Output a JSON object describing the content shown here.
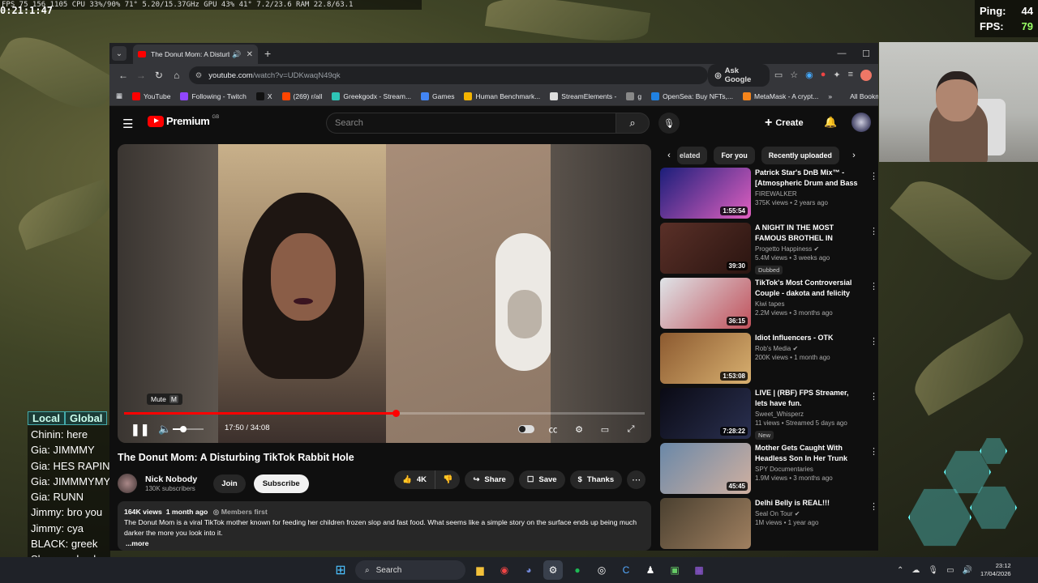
{
  "overlay": {
    "stats": "FPS 75 156 1105   CPU 33%/90%   71°  5.20/15.37GHz   GPU 43%  41°  7.2/23.6   RAM 22.8/63.1",
    "timer": "0:21:1:47",
    "ping_label": "Ping:",
    "ping_value": "44",
    "fps_label": "FPS:",
    "fps_value": "79"
  },
  "chat": {
    "tabs": [
      "Local",
      "Global"
    ],
    "messages": [
      "Chinin:  here",
      "Gia:  JIMMMY",
      "Gia:  HES RAPIN",
      "Gia:  JIMMMYMY",
      "Gia:  RUNN",
      "Jimmy:  bro you",
      "Jimmy:  cya",
      "BLACK:  greek",
      "Skyy:  my bush"
    ]
  },
  "browser": {
    "tab_title": "The Donut Mom: A Disturb",
    "url_prefix": "youtube.com",
    "url_rest": "/watch?v=UDKwaqN49qk",
    "ask_google": "Ask Google",
    "bookmarks": [
      {
        "label": "YouTube",
        "color": "#ff0000"
      },
      {
        "label": "Following - Twitch",
        "color": "#9146ff"
      },
      {
        "label": "X",
        "color": "#111111"
      },
      {
        "label": "(269) r/all",
        "color": "#ff4500"
      },
      {
        "label": "Greekgodx - Stream...",
        "color": "#2ec4b6"
      },
      {
        "label": "Games",
        "color": "#4285f4"
      },
      {
        "label": "Human Benchmark...",
        "color": "#f4b400"
      },
      {
        "label": "StreamElements -",
        "color": "#dddddd"
      },
      {
        "label": "g",
        "color": "#888888"
      },
      {
        "label": "OpenSea: Buy NFTs,...",
        "color": "#2081e2"
      },
      {
        "label": "MetaMask - A crypt...",
        "color": "#f6851b"
      }
    ],
    "all_bookmarks": "All Bookma"
  },
  "youtube": {
    "logo_text": "Premium",
    "logo_region": "GB",
    "search_placeholder": "Search",
    "create_label": "Create",
    "video": {
      "title": "The Donut Mom: A Disturbing TikTok Rabbit Hole",
      "current_time": "17:50",
      "duration": "34:08",
      "progress": 0.5225,
      "volume": 0.35,
      "mute_tooltip": "Mute",
      "mute_key": "M"
    },
    "channel": {
      "name": "Nick Nobody",
      "subs": "130K subscribers",
      "join": "Join",
      "subscribe": "Subscribe"
    },
    "actions": {
      "likes": "4K",
      "share": "Share",
      "save": "Save",
      "thanks": "Thanks"
    },
    "description": {
      "views": "164K views",
      "age": "1 month ago",
      "members": "Members first",
      "text": "The Donut Mom is a viral TikTok mother known for feeding her children frozen slop and fast food. What seems like a simple story on the surface ends up being much darker the more you look into it.",
      "more": "...more"
    },
    "chips": [
      "elated",
      "For you",
      "Recently uploaded"
    ],
    "recommendations": [
      {
        "title": "Patrick Star's DnB Mix™ - [Atmospheric Drum and Bass ...",
        "channel": "FIREWALKER",
        "verified": false,
        "meta": "375K views • 2 years ago",
        "duration": "1:55:54",
        "badge": "",
        "thumb": [
          "#1b1e7a",
          "#e060c0"
        ]
      },
      {
        "title": "A NIGHT IN THE MOST FAMOUS BROTHEL IN EUROPE AT",
        "channel": "Progetto Happiness",
        "verified": true,
        "meta": "5.4M views • 3 weeks ago",
        "duration": "39:30",
        "badge": "Dubbed",
        "thumb": [
          "#5a3028",
          "#2a1410"
        ]
      },
      {
        "title": "TikTok's Most Controversial Couple - dakota and felicity",
        "channel": "Kiwi tapes",
        "verified": false,
        "meta": "2.2M views • 3 months ago",
        "duration": "36:15",
        "badge": "",
        "thumb": [
          "#dfe4e8",
          "#c0505a"
        ]
      },
      {
        "title": "Idiot Influencers - OTK",
        "channel": "Rob's Media",
        "verified": true,
        "meta": "200K views • 1 month ago",
        "duration": "1:53:08",
        "badge": "",
        "thumb": [
          "#8c5a30",
          "#d8b070"
        ]
      },
      {
        "title": "LIVE | (RBF) FPS Streamer, lets have fun.",
        "channel": "Sweet_Whisperz",
        "verified": false,
        "meta": "11 views • Streamed 5 days ago",
        "duration": "7:28:22",
        "badge": "New",
        "thumb": [
          "#0a0a14",
          "#2a3050"
        ]
      },
      {
        "title": "Mother Gets Caught With Headless Son In Her Trunk",
        "channel": "SPY Documentaries",
        "verified": false,
        "meta": "1.9M views • 3 months ago",
        "duration": "45:45",
        "badge": "",
        "thumb": [
          "#6a88a8",
          "#d0b0a0"
        ]
      },
      {
        "title": "Delhi Belly is REAL!!!",
        "channel": "Seal On Tour",
        "verified": true,
        "meta": "1M views • 1 year ago",
        "duration": "",
        "badge": "",
        "thumb": [
          "#4a4030",
          "#a08060"
        ]
      }
    ]
  },
  "taskbar": {
    "search": "Search",
    "time": "23:12",
    "date": "17/04/2026"
  }
}
